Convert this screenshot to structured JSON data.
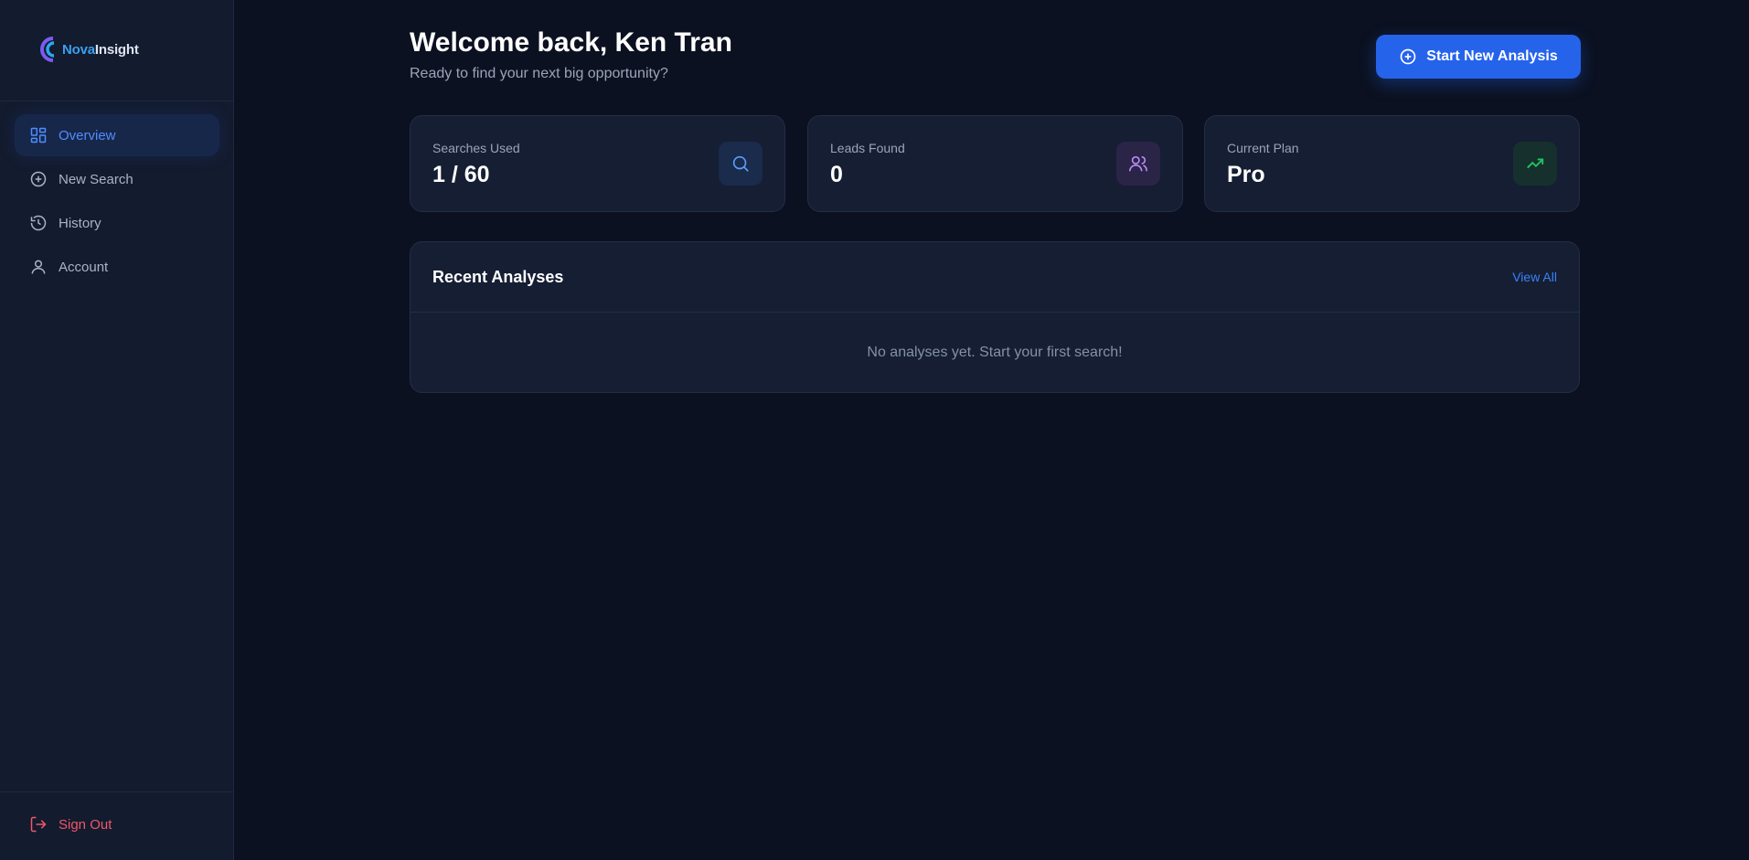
{
  "brand": {
    "name_part1": "Nova",
    "name_part2": "Insight"
  },
  "sidebar": {
    "items": [
      {
        "label": "Overview",
        "icon": "dashboard-icon",
        "active": true
      },
      {
        "label": "New Search",
        "icon": "plus-circle-icon",
        "active": false
      },
      {
        "label": "History",
        "icon": "history-icon",
        "active": false
      },
      {
        "label": "Account",
        "icon": "user-icon",
        "active": false
      }
    ],
    "signout_label": "Sign Out"
  },
  "header": {
    "title": "Welcome back, Ken Tran",
    "subtitle": "Ready to find your next big opportunity?",
    "primary_button": "Start New Analysis"
  },
  "stats": [
    {
      "label": "Searches Used",
      "value": "1 / 60",
      "icon": "search-icon"
    },
    {
      "label": "Leads Found",
      "value": "0",
      "icon": "users-icon"
    },
    {
      "label": "Current Plan",
      "value": "Pro",
      "icon": "trending-up-icon"
    }
  ],
  "recent": {
    "title": "Recent Analyses",
    "view_all": "View All",
    "empty_text": "No analyses yet. Start your first search!"
  },
  "colors": {
    "background": "#0b1120",
    "sidebar": "#131b2e",
    "card": "#151e33",
    "accent": "#2563eb",
    "active_text": "#4f8dff",
    "danger": "#f2566a",
    "success": "#22c55e",
    "purple": "#b98cf5"
  }
}
